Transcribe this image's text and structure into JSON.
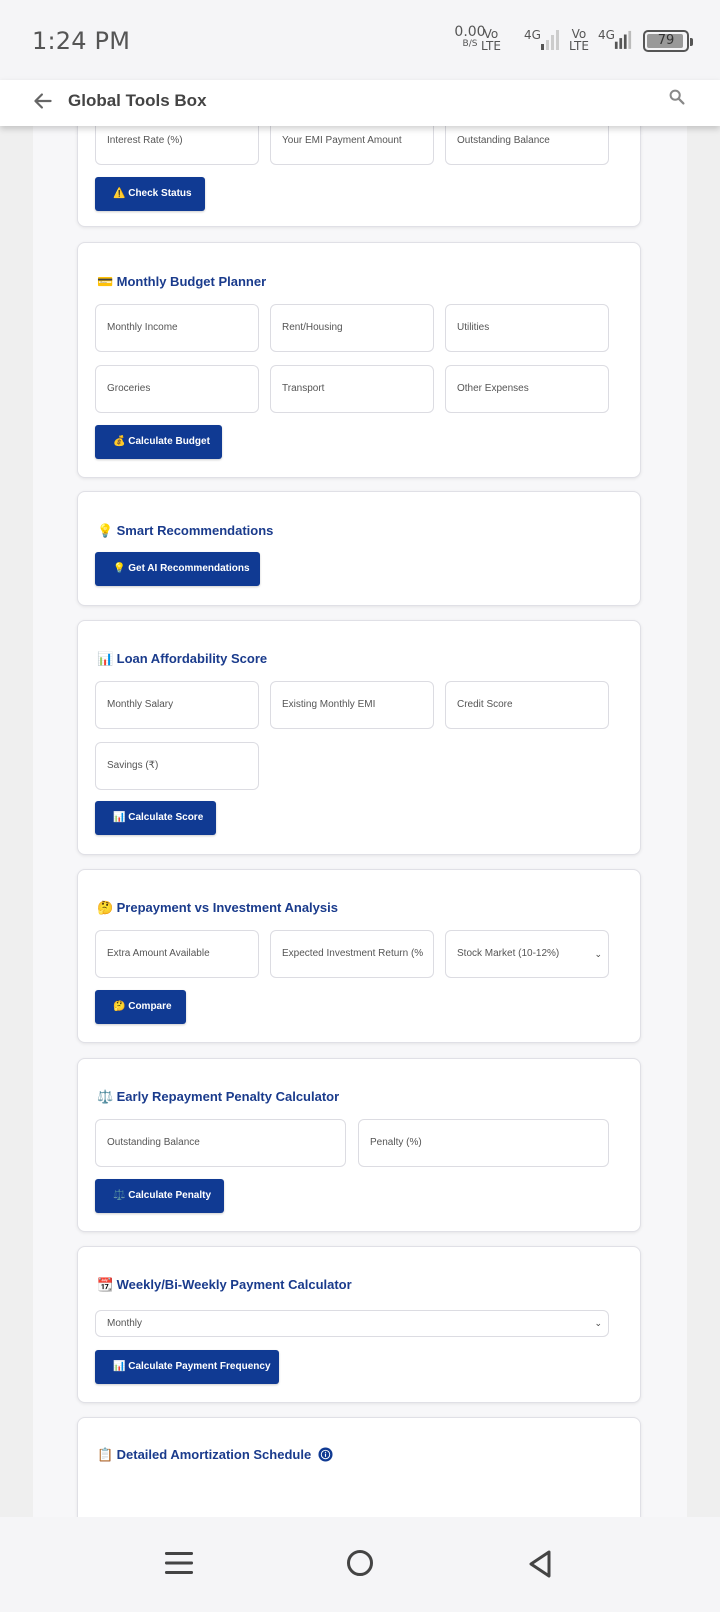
{
  "status_bar": {
    "time": "1:24 PM",
    "speed_value": "0.00",
    "speed_unit": "B/S",
    "sim1_vo": "Vo",
    "sim1_lte": "LTE",
    "sim1_net": "4G",
    "sim2_vo": "Vo",
    "sim2_lte": "LTE",
    "sim2_net": "4G",
    "battery": "79"
  },
  "app_bar": {
    "title": "Global Tools Box",
    "back_icon": "arrow-left-icon",
    "search_icon": "search-icon"
  },
  "card_status": {
    "fields": [
      "Interest Rate (%)",
      "Your EMI Payment Amount",
      "Outstanding Balance"
    ],
    "button": "⚠️ Check Status"
  },
  "card_budget": {
    "title_icon": "💳",
    "title": "Monthly Budget Planner",
    "fields": [
      "Monthly Income",
      "Rent/Housing",
      "Utilities",
      "Groceries",
      "Transport",
      "Other Expenses"
    ],
    "button": "💰 Calculate Budget"
  },
  "card_recommend": {
    "title_icon": "💡",
    "title": "Smart Recommendations",
    "button": "💡 Get AI Recommendations"
  },
  "card_afford": {
    "title_icon": "📊",
    "title": "Loan Affordability Score",
    "fields": [
      "Monthly Salary",
      "Existing Monthly EMI",
      "Credit Score",
      "Savings (₹)"
    ],
    "button": "📊 Calculate Score"
  },
  "card_prepay": {
    "title_icon": "🤔",
    "title": "Prepayment vs Investment Analysis",
    "fields": [
      "Extra Amount Available",
      "Expected Investment Return (%"
    ],
    "select_value": "Stock Market (10-12%)",
    "button": "🤔 Compare"
  },
  "card_penalty": {
    "title_icon": "⚖️",
    "title": "Early Repayment Penalty Calculator",
    "fields": [
      "Outstanding Balance",
      "Penalty (%)"
    ],
    "button": "⚖️ Calculate Penalty"
  },
  "card_frequency": {
    "title_icon": "📆",
    "title": "Weekly/Bi-Weekly Payment Calculator",
    "select_value": "Monthly",
    "button": "📊 Calculate Payment Frequency"
  },
  "card_amortization": {
    "title_icon": "📋",
    "title": "Detailed Amortization Schedule",
    "info_icon": "info-icon"
  },
  "nav": {
    "menu_icon": "recent-apps-icon",
    "home_icon": "home-icon",
    "back_icon": "back-triangle-icon"
  },
  "colors": {
    "accent": "#103a93",
    "title": "#1a3b8c"
  }
}
